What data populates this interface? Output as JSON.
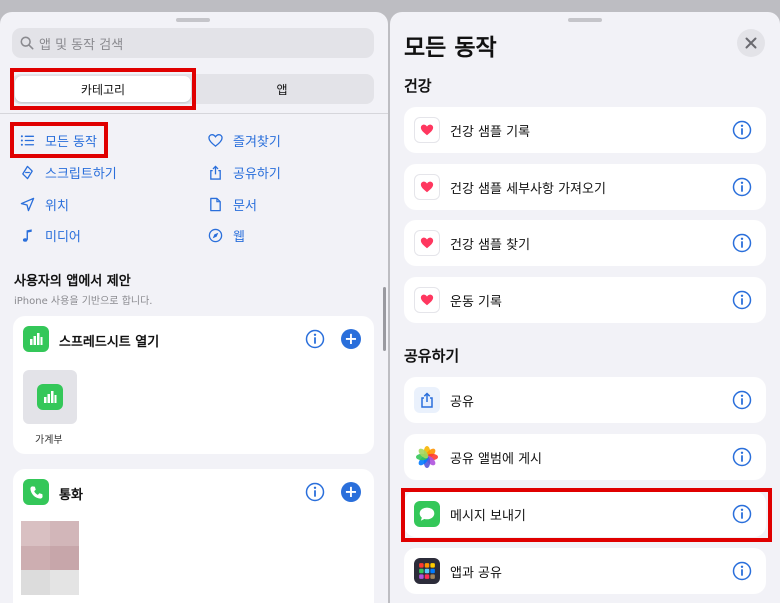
{
  "left": {
    "search_placeholder": "앱 및 동작 검색",
    "segments": [
      "카테고리",
      "앱"
    ],
    "categories": [
      {
        "label": "모든 동작",
        "icon": "list-icon"
      },
      {
        "label": "즐겨찾기",
        "icon": "heart-icon"
      },
      {
        "label": "스크립트하기",
        "icon": "scripting-icon"
      },
      {
        "label": "공유하기",
        "icon": "share-icon"
      },
      {
        "label": "위치",
        "icon": "location-arrow-icon"
      },
      {
        "label": "문서",
        "icon": "document-icon"
      },
      {
        "label": "미디어",
        "icon": "music-note-icon"
      },
      {
        "label": "웹",
        "icon": "compass-icon"
      }
    ],
    "suggestions_title": "사용자의 앱에서 제안",
    "suggestions_subtitle": "iPhone 사용을 기반으로 합니다.",
    "cards": [
      {
        "title": "스프레드시트 열기",
        "item_label": "가계부"
      },
      {
        "title": "통화"
      }
    ]
  },
  "right": {
    "title": "모든 동작",
    "sections": [
      {
        "title": "건강",
        "items": [
          "건강 샘플 기록",
          "건강 샘플 세부사항 가져오기",
          "건강 샘플 찾기",
          "운동 기록"
        ]
      },
      {
        "title": "공유하기",
        "items": [
          "공유",
          "공유 앨범에 게시",
          "메시지 보내기",
          "앱과 공유"
        ]
      }
    ]
  },
  "colors": {
    "accent": "#2a6fdb",
    "highlight": "#e00000",
    "numbers_green": "#34c759",
    "phone_green": "#34c759",
    "messages_green": "#34c759",
    "health_red": "#ff375f"
  }
}
